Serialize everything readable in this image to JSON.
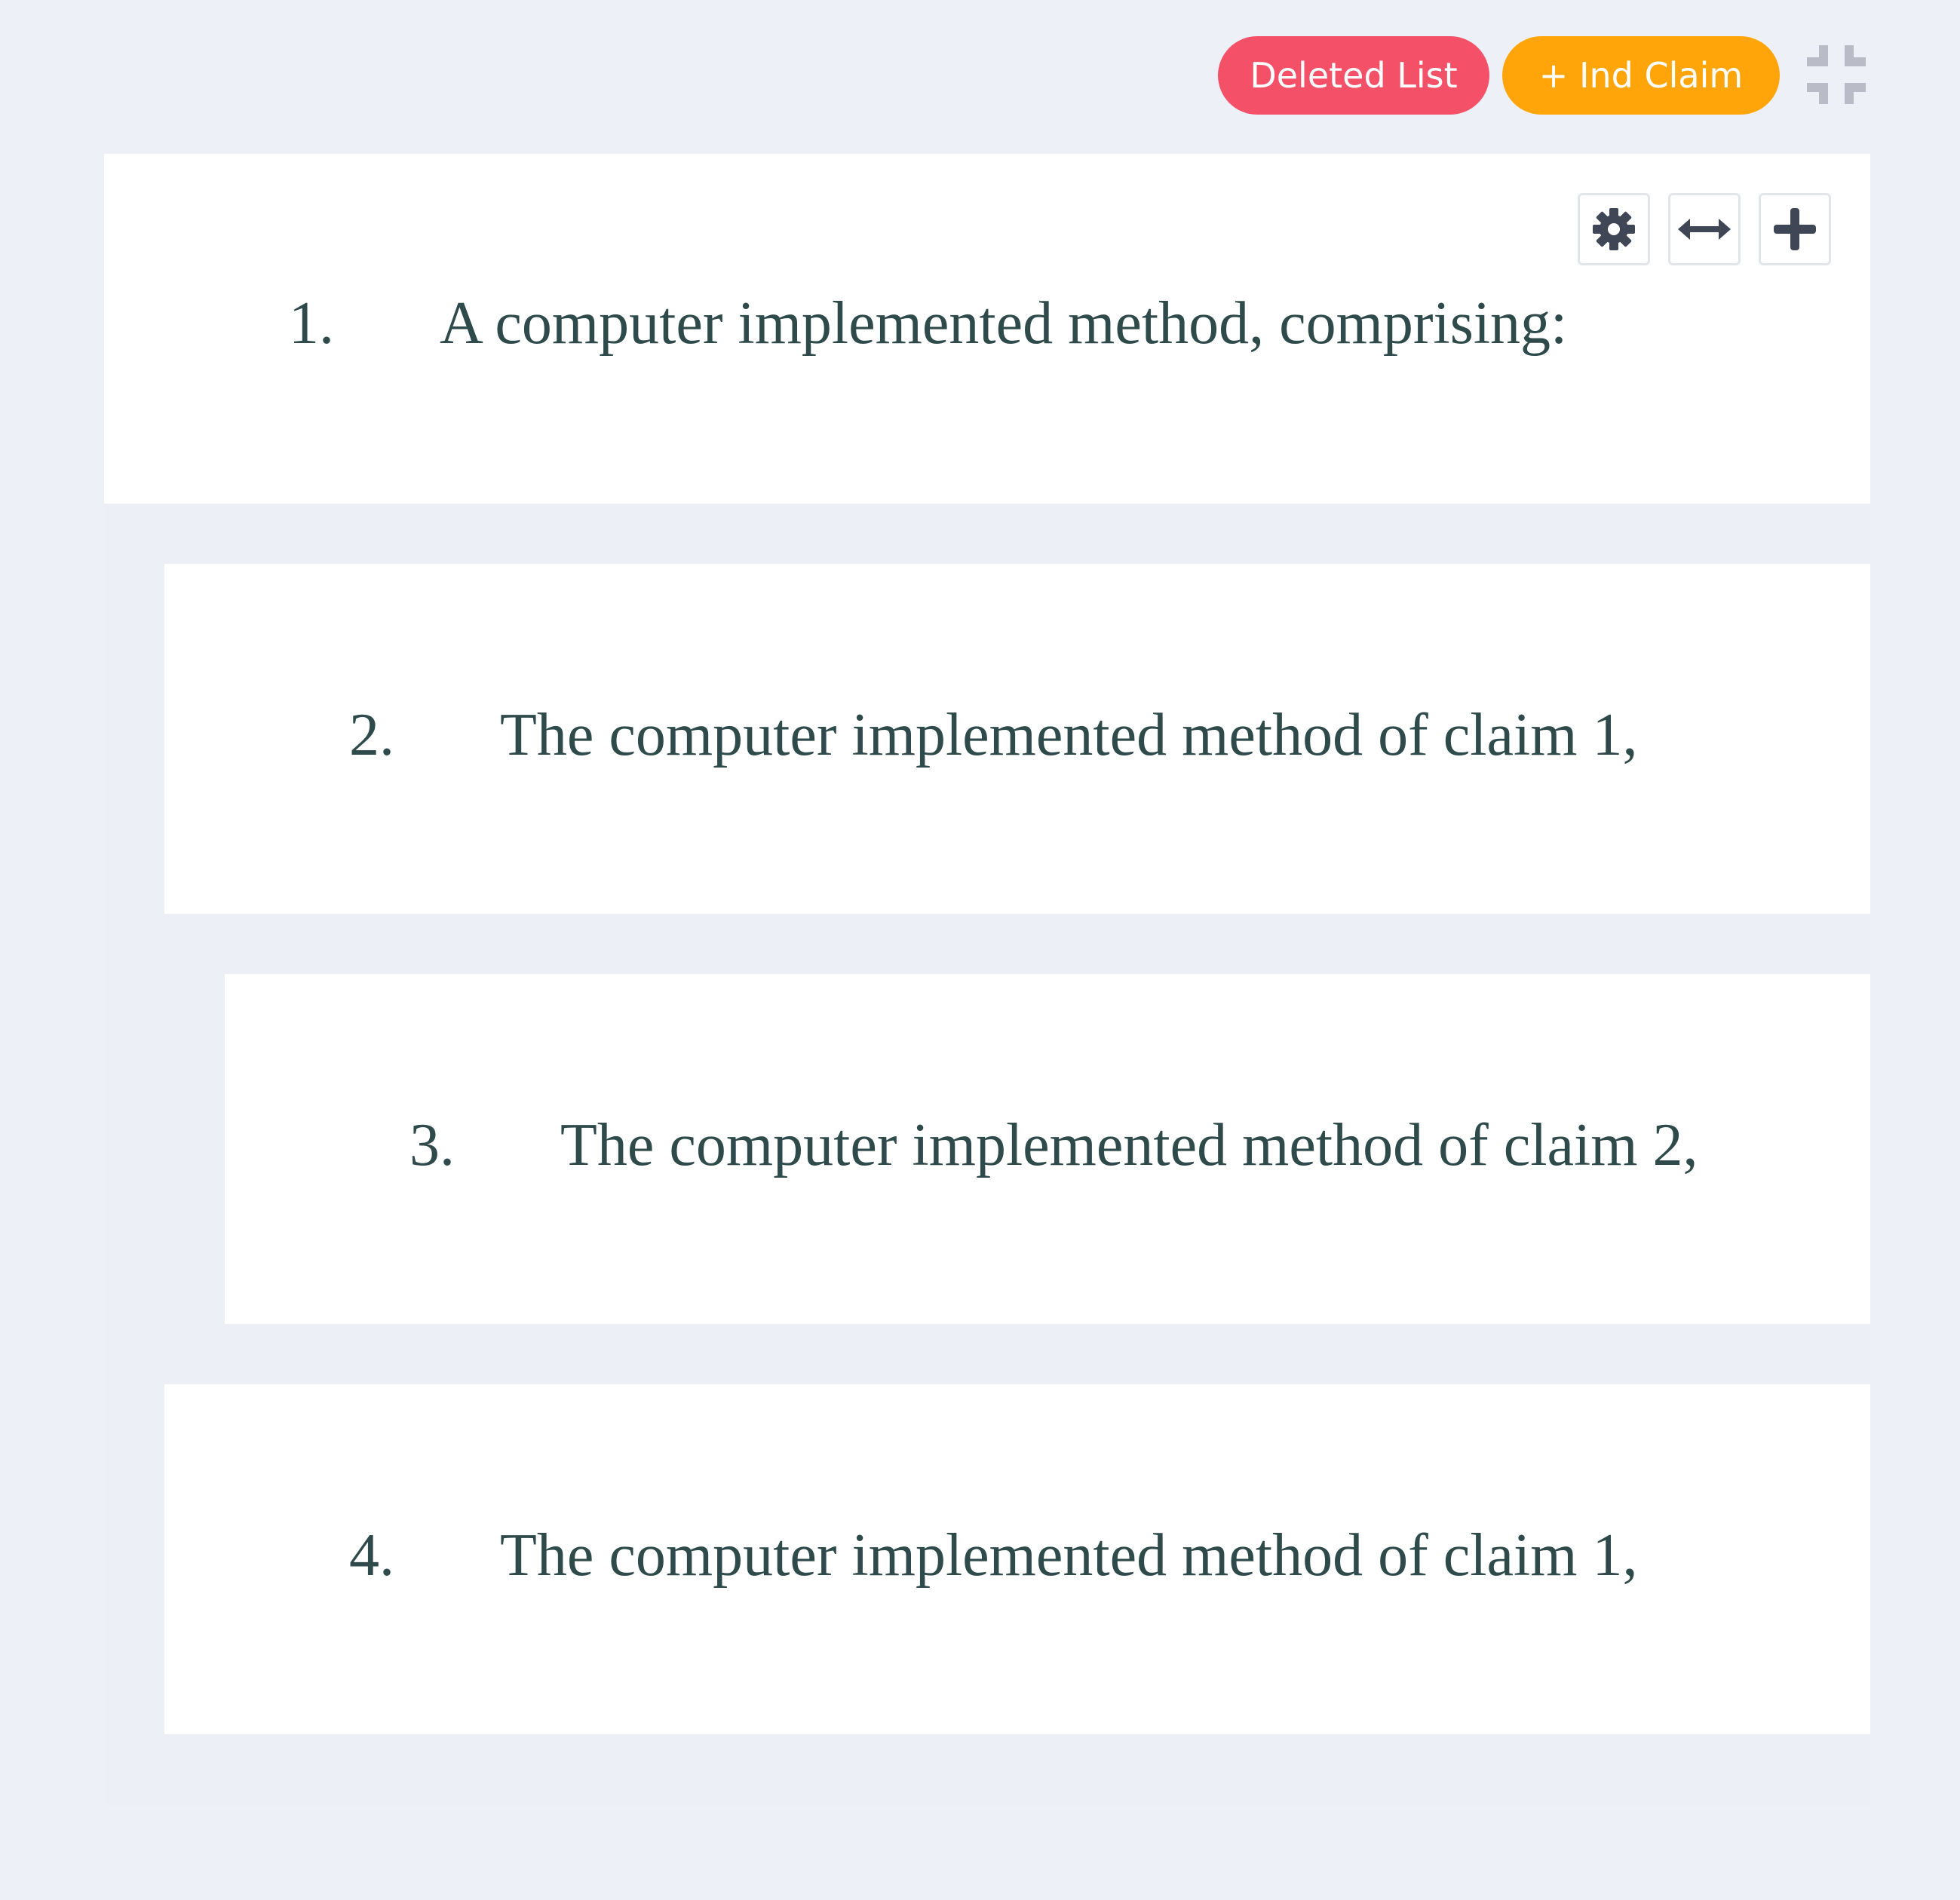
{
  "toolbar": {
    "deleted_list_label": "Deleted List",
    "add_ind_claim_label": "+ Ind Claim",
    "collapse_icon": "collapse-icon"
  },
  "colors": {
    "background": "#edf0f7",
    "deleted_list": "#f45168",
    "add_ind_claim": "#ffa50a",
    "claim_text": "#2f4a4a",
    "icon_dark": "#3f4656",
    "icon_light": "#b9bcc6"
  },
  "claim_tools": {
    "settings_icon": "gear-icon",
    "width_icon": "arrows-horizontal-icon",
    "add_icon": "plus-icon"
  },
  "claims": [
    {
      "number": "1.",
      "text": "A computer implemented method, comprising:"
    },
    {
      "number": "2.",
      "text": "The computer implemented method of claim 1,"
    },
    {
      "number": "3.",
      "text": "The computer implemented method of claim 2,"
    },
    {
      "number": "4.",
      "text": "The computer implemented method of claim 1,"
    }
  ]
}
